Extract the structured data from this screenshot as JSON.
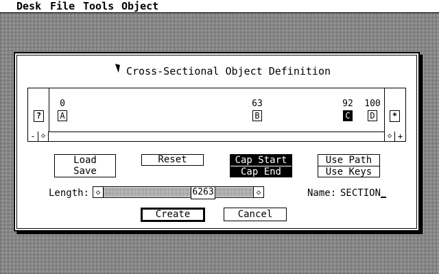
{
  "menubar": {
    "items": [
      "Desk",
      "File",
      "Tools",
      "Object"
    ]
  },
  "dialog": {
    "title": "Cross-Sectional Object Definition",
    "track": {
      "left_button": "?",
      "right_button": "*",
      "scroll_minus": "-",
      "scroll_left": "◇",
      "scroll_right": "◇",
      "scroll_plus": "+",
      "keys": [
        {
          "num": "0",
          "label": "A",
          "selected": false
        },
        {
          "num": "63",
          "label": "B",
          "selected": false
        },
        {
          "num": "92",
          "label": "C",
          "selected": true
        },
        {
          "num": "100",
          "label": "D",
          "selected": false
        }
      ]
    },
    "buttons": {
      "load": "Load",
      "save": "Save",
      "reset": "Reset",
      "cap_start": "Cap Start",
      "cap_end": "Cap End",
      "use_path": "Use Path",
      "use_keys": "Use Keys",
      "create": "Create",
      "cancel": "Cancel"
    },
    "length": {
      "label": "Length:",
      "value": "6263",
      "left_arrow": "◇",
      "right_arrow": "◇"
    },
    "name": {
      "label": "Name:",
      "value": "SECTION"
    }
  }
}
